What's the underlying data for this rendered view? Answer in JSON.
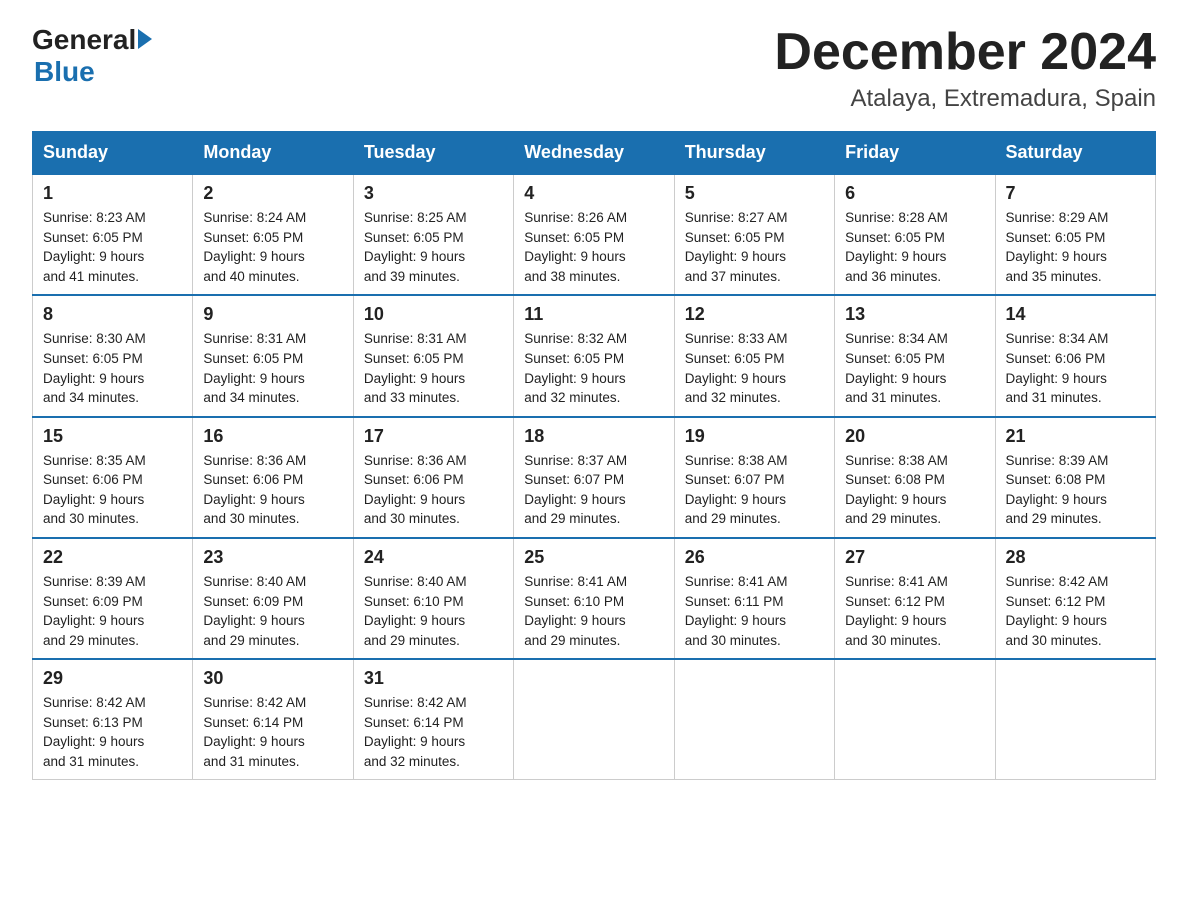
{
  "header": {
    "logo_general": "General",
    "logo_blue": "Blue",
    "month_title": "December 2024",
    "location": "Atalaya, Extremadura, Spain"
  },
  "days_of_week": [
    "Sunday",
    "Monday",
    "Tuesday",
    "Wednesday",
    "Thursday",
    "Friday",
    "Saturday"
  ],
  "weeks": [
    [
      {
        "num": "1",
        "sunrise": "8:23 AM",
        "sunset": "6:05 PM",
        "daylight": "9 hours and 41 minutes."
      },
      {
        "num": "2",
        "sunrise": "8:24 AM",
        "sunset": "6:05 PM",
        "daylight": "9 hours and 40 minutes."
      },
      {
        "num": "3",
        "sunrise": "8:25 AM",
        "sunset": "6:05 PM",
        "daylight": "9 hours and 39 minutes."
      },
      {
        "num": "4",
        "sunrise": "8:26 AM",
        "sunset": "6:05 PM",
        "daylight": "9 hours and 38 minutes."
      },
      {
        "num": "5",
        "sunrise": "8:27 AM",
        "sunset": "6:05 PM",
        "daylight": "9 hours and 37 minutes."
      },
      {
        "num": "6",
        "sunrise": "8:28 AM",
        "sunset": "6:05 PM",
        "daylight": "9 hours and 36 minutes."
      },
      {
        "num": "7",
        "sunrise": "8:29 AM",
        "sunset": "6:05 PM",
        "daylight": "9 hours and 35 minutes."
      }
    ],
    [
      {
        "num": "8",
        "sunrise": "8:30 AM",
        "sunset": "6:05 PM",
        "daylight": "9 hours and 34 minutes."
      },
      {
        "num": "9",
        "sunrise": "8:31 AM",
        "sunset": "6:05 PM",
        "daylight": "9 hours and 34 minutes."
      },
      {
        "num": "10",
        "sunrise": "8:31 AM",
        "sunset": "6:05 PM",
        "daylight": "9 hours and 33 minutes."
      },
      {
        "num": "11",
        "sunrise": "8:32 AM",
        "sunset": "6:05 PM",
        "daylight": "9 hours and 32 minutes."
      },
      {
        "num": "12",
        "sunrise": "8:33 AM",
        "sunset": "6:05 PM",
        "daylight": "9 hours and 32 minutes."
      },
      {
        "num": "13",
        "sunrise": "8:34 AM",
        "sunset": "6:05 PM",
        "daylight": "9 hours and 31 minutes."
      },
      {
        "num": "14",
        "sunrise": "8:34 AM",
        "sunset": "6:06 PM",
        "daylight": "9 hours and 31 minutes."
      }
    ],
    [
      {
        "num": "15",
        "sunrise": "8:35 AM",
        "sunset": "6:06 PM",
        "daylight": "9 hours and 30 minutes."
      },
      {
        "num": "16",
        "sunrise": "8:36 AM",
        "sunset": "6:06 PM",
        "daylight": "9 hours and 30 minutes."
      },
      {
        "num": "17",
        "sunrise": "8:36 AM",
        "sunset": "6:06 PM",
        "daylight": "9 hours and 30 minutes."
      },
      {
        "num": "18",
        "sunrise": "8:37 AM",
        "sunset": "6:07 PM",
        "daylight": "9 hours and 29 minutes."
      },
      {
        "num": "19",
        "sunrise": "8:38 AM",
        "sunset": "6:07 PM",
        "daylight": "9 hours and 29 minutes."
      },
      {
        "num": "20",
        "sunrise": "8:38 AM",
        "sunset": "6:08 PM",
        "daylight": "9 hours and 29 minutes."
      },
      {
        "num": "21",
        "sunrise": "8:39 AM",
        "sunset": "6:08 PM",
        "daylight": "9 hours and 29 minutes."
      }
    ],
    [
      {
        "num": "22",
        "sunrise": "8:39 AM",
        "sunset": "6:09 PM",
        "daylight": "9 hours and 29 minutes."
      },
      {
        "num": "23",
        "sunrise": "8:40 AM",
        "sunset": "6:09 PM",
        "daylight": "9 hours and 29 minutes."
      },
      {
        "num": "24",
        "sunrise": "8:40 AM",
        "sunset": "6:10 PM",
        "daylight": "9 hours and 29 minutes."
      },
      {
        "num": "25",
        "sunrise": "8:41 AM",
        "sunset": "6:10 PM",
        "daylight": "9 hours and 29 minutes."
      },
      {
        "num": "26",
        "sunrise": "8:41 AM",
        "sunset": "6:11 PM",
        "daylight": "9 hours and 30 minutes."
      },
      {
        "num": "27",
        "sunrise": "8:41 AM",
        "sunset": "6:12 PM",
        "daylight": "9 hours and 30 minutes."
      },
      {
        "num": "28",
        "sunrise": "8:42 AM",
        "sunset": "6:12 PM",
        "daylight": "9 hours and 30 minutes."
      }
    ],
    [
      {
        "num": "29",
        "sunrise": "8:42 AM",
        "sunset": "6:13 PM",
        "daylight": "9 hours and 31 minutes."
      },
      {
        "num": "30",
        "sunrise": "8:42 AM",
        "sunset": "6:14 PM",
        "daylight": "9 hours and 31 minutes."
      },
      {
        "num": "31",
        "sunrise": "8:42 AM",
        "sunset": "6:14 PM",
        "daylight": "9 hours and 32 minutes."
      },
      null,
      null,
      null,
      null
    ]
  ],
  "labels": {
    "sunrise": "Sunrise:",
    "sunset": "Sunset:",
    "daylight": "Daylight:"
  }
}
